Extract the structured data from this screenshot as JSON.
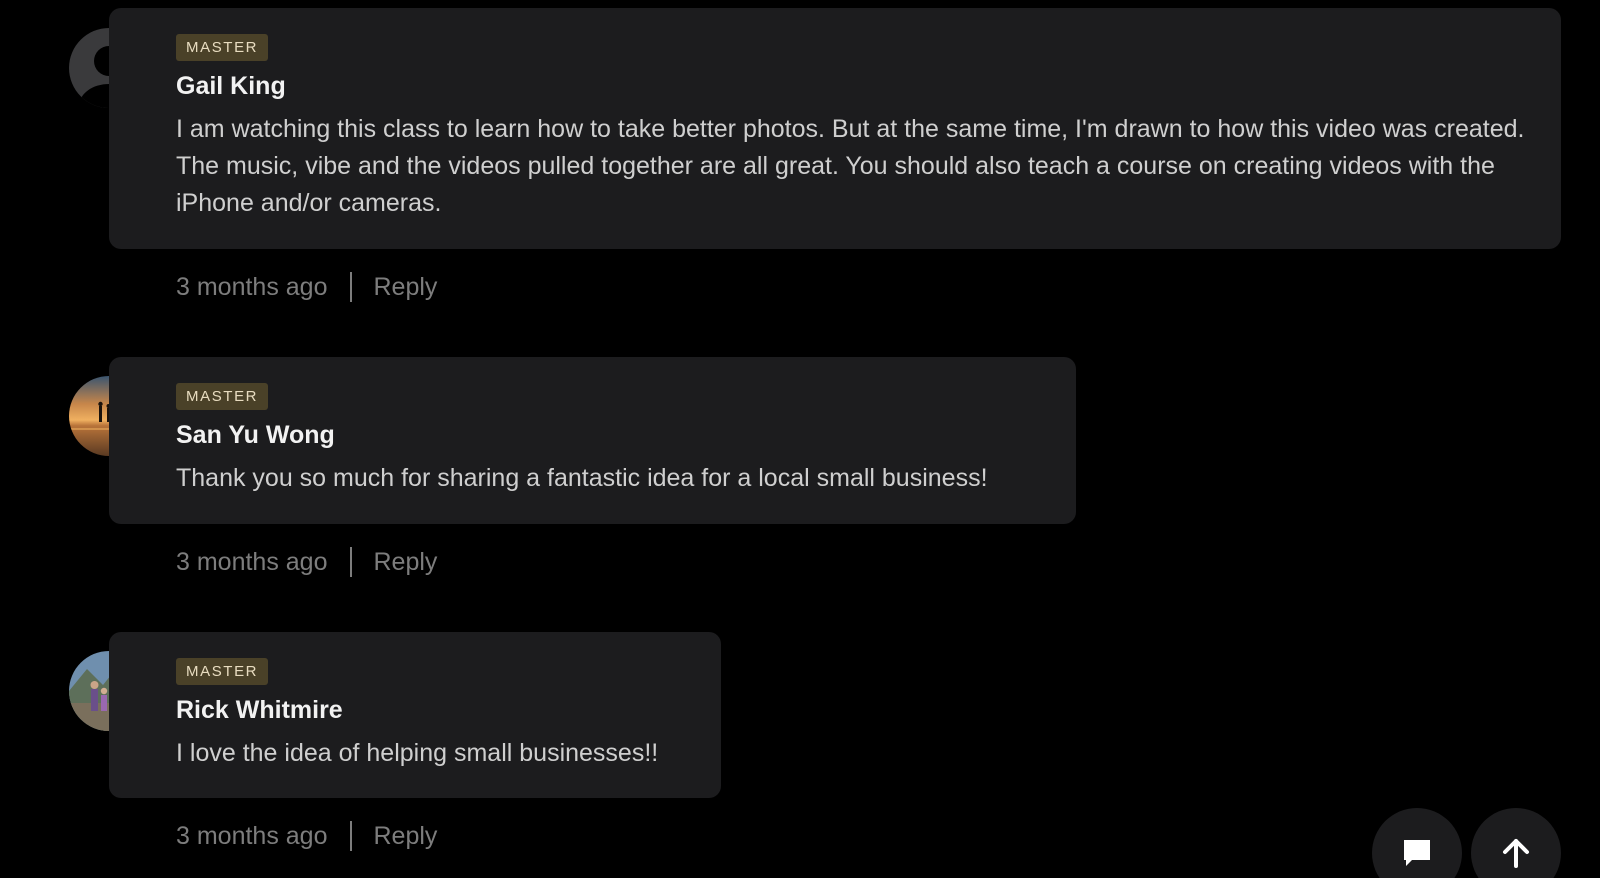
{
  "comments": [
    {
      "badge": "MASTER",
      "author": "Gail King",
      "text": "I am watching this class to learn how to take better photos. But at the same time, I'm drawn to how this video was created. The music, vibe and the videos pulled together are all great. You should also teach a course on creating videos with the iPhone and/or cameras.",
      "time": "3 months ago",
      "reply_label": "Reply",
      "avatar": "default-user-silhouette"
    },
    {
      "badge": "MASTER",
      "author": "San Yu Wong",
      "text": "Thank you so much for sharing a fantastic idea for a local small business!",
      "time": "3 months ago",
      "reply_label": "Reply",
      "avatar": "sunset-beach-photo"
    },
    {
      "badge": "MASTER",
      "author": "Rick Whitmire",
      "text": "I love the idea of helping small businesses!!",
      "time": "3 months ago",
      "reply_label": "Reply",
      "avatar": "outdoor-family-photo"
    }
  ],
  "floating_actions": {
    "comment_icon": "speech-bubble-icon",
    "scroll_top_icon": "arrow-up-icon"
  },
  "colors": {
    "background": "#000000",
    "card": "#1c1c1e",
    "badge_bg": "#4a4128",
    "badge_text": "#e8dcc0",
    "meta_text": "#7d7d7d"
  }
}
